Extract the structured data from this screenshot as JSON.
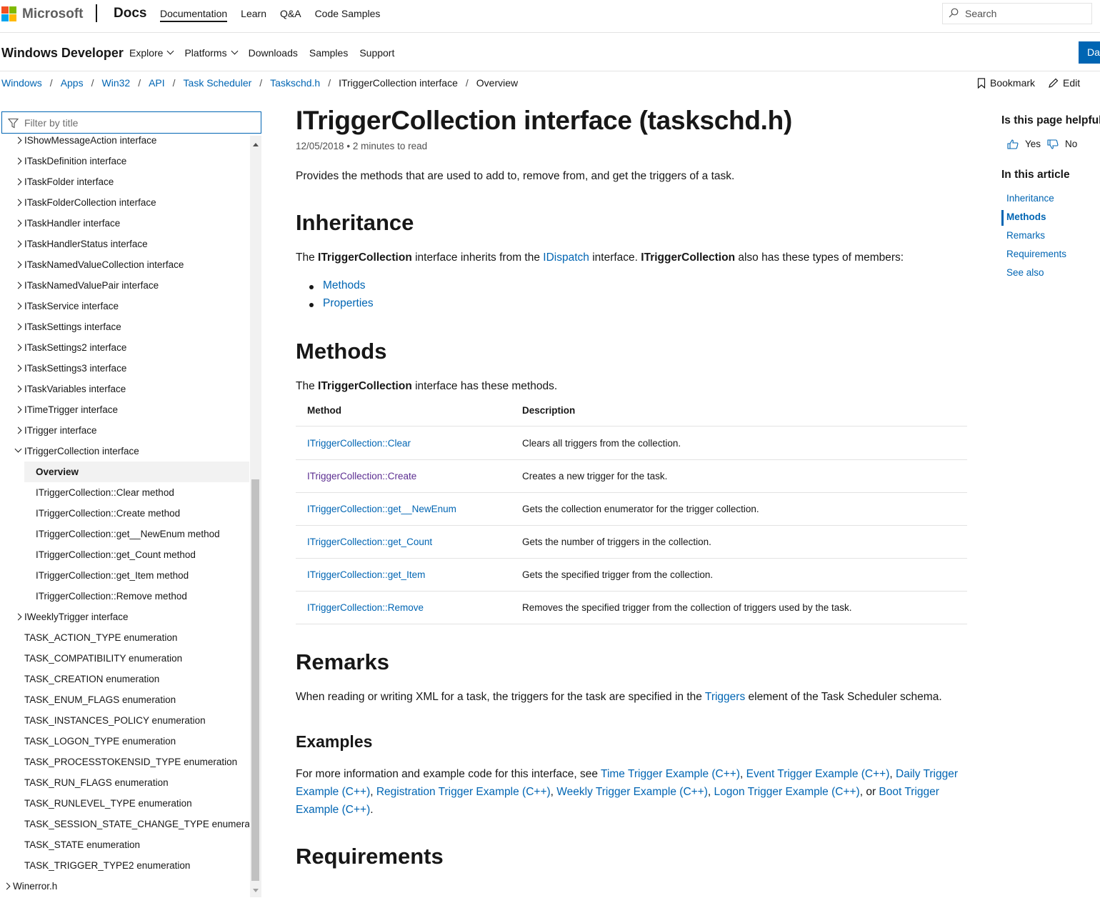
{
  "header": {
    "brand": "Microsoft",
    "site": "Docs",
    "nav": [
      "Documentation",
      "Learn",
      "Q&A",
      "Code Samples"
    ],
    "search_placeholder": "Search"
  },
  "subheader": {
    "title": "Windows Developer",
    "nav": [
      "Explore",
      "Platforms",
      "Downloads",
      "Samples",
      "Support"
    ],
    "button": "Da"
  },
  "breadcrumb": [
    "Windows",
    "Apps",
    "Win32",
    "API",
    "Task Scheduler",
    "Taskschd.h",
    "ITriggerCollection interface",
    "Overview"
  ],
  "actions": {
    "bookmark": "Bookmark",
    "edit": "Edit"
  },
  "sidebar": {
    "filter_placeholder": "Filter by title",
    "items": [
      {
        "label": "IShowMessageAction interface",
        "level": 1,
        "chevron": "closed"
      },
      {
        "label": "ITaskDefinition interface",
        "level": 1,
        "chevron": "closed"
      },
      {
        "label": "ITaskFolder interface",
        "level": 1,
        "chevron": "closed"
      },
      {
        "label": "ITaskFolderCollection interface",
        "level": 1,
        "chevron": "closed"
      },
      {
        "label": "ITaskHandler interface",
        "level": 1,
        "chevron": "closed"
      },
      {
        "label": "ITaskHandlerStatus interface",
        "level": 1,
        "chevron": "closed"
      },
      {
        "label": "ITaskNamedValueCollection interface",
        "level": 1,
        "chevron": "closed"
      },
      {
        "label": "ITaskNamedValuePair interface",
        "level": 1,
        "chevron": "closed"
      },
      {
        "label": "ITaskService interface",
        "level": 1,
        "chevron": "closed"
      },
      {
        "label": "ITaskSettings interface",
        "level": 1,
        "chevron": "closed"
      },
      {
        "label": "ITaskSettings2 interface",
        "level": 1,
        "chevron": "closed"
      },
      {
        "label": "ITaskSettings3 interface",
        "level": 1,
        "chevron": "closed"
      },
      {
        "label": "ITaskVariables interface",
        "level": 1,
        "chevron": "closed"
      },
      {
        "label": "ITimeTrigger interface",
        "level": 1,
        "chevron": "closed"
      },
      {
        "label": "ITrigger interface",
        "level": 1,
        "chevron": "closed"
      },
      {
        "label": "ITriggerCollection interface",
        "level": 1,
        "chevron": "open"
      },
      {
        "label": "Overview",
        "level": 2,
        "chevron": "none",
        "selected": true
      },
      {
        "label": "ITriggerCollection::Clear method",
        "level": 2,
        "chevron": "none"
      },
      {
        "label": "ITriggerCollection::Create method",
        "level": 2,
        "chevron": "none"
      },
      {
        "label": "ITriggerCollection::get__NewEnum method",
        "level": 2,
        "chevron": "none"
      },
      {
        "label": "ITriggerCollection::get_Count method",
        "level": 2,
        "chevron": "none"
      },
      {
        "label": "ITriggerCollection::get_Item method",
        "level": 2,
        "chevron": "none"
      },
      {
        "label": "ITriggerCollection::Remove method",
        "level": 2,
        "chevron": "none"
      },
      {
        "label": "IWeeklyTrigger interface",
        "level": 1,
        "chevron": "closed"
      },
      {
        "label": "TASK_ACTION_TYPE enumeration",
        "level": 1,
        "chevron": "none"
      },
      {
        "label": "TASK_COMPATIBILITY enumeration",
        "level": 1,
        "chevron": "none"
      },
      {
        "label": "TASK_CREATION enumeration",
        "level": 1,
        "chevron": "none"
      },
      {
        "label": "TASK_ENUM_FLAGS enumeration",
        "level": 1,
        "chevron": "none"
      },
      {
        "label": "TASK_INSTANCES_POLICY enumeration",
        "level": 1,
        "chevron": "none"
      },
      {
        "label": "TASK_LOGON_TYPE enumeration",
        "level": 1,
        "chevron": "none"
      },
      {
        "label": "TASK_PROCESSTOKENSID_TYPE enumeration",
        "level": 1,
        "chevron": "none"
      },
      {
        "label": "TASK_RUN_FLAGS enumeration",
        "level": 1,
        "chevron": "none"
      },
      {
        "label": "TASK_RUNLEVEL_TYPE enumeration",
        "level": 1,
        "chevron": "none"
      },
      {
        "label": "TASK_SESSION_STATE_CHANGE_TYPE enumeration",
        "level": 1,
        "chevron": "none"
      },
      {
        "label": "TASK_STATE enumeration",
        "level": 1,
        "chevron": "none"
      },
      {
        "label": "TASK_TRIGGER_TYPE2 enumeration",
        "level": 1,
        "chevron": "none"
      },
      {
        "label": "Winerror.h",
        "level": 0,
        "chevron": "closed"
      }
    ]
  },
  "article": {
    "title": "ITriggerCollection interface (taskschd.h)",
    "date": "12/05/2018",
    "read_time": "2 minutes to read",
    "intro": "Provides the methods that are used to add to, remove from, and get the triggers of a task.",
    "inheritance": {
      "heading": "Inheritance",
      "p_the": "The ",
      "name": "ITriggerCollection",
      "p_mid": " interface inherits from the ",
      "link": "IDispatch",
      "p_mid2": " interface. ",
      "name2": "ITriggerCollection",
      "p_end": " also has these types of members:",
      "bullets": [
        "Methods",
        "Properties"
      ]
    },
    "methods": {
      "heading": "Methods",
      "p_the": "The ",
      "name": "ITriggerCollection",
      "p_end": " interface has these methods.",
      "col_method": "Method",
      "col_desc": "Description",
      "rows": [
        {
          "method": "ITriggerCollection::Clear",
          "desc": "Clears all triggers from the collection."
        },
        {
          "method": "ITriggerCollection::Create",
          "desc": "Creates a new trigger for the task."
        },
        {
          "method": "ITriggerCollection::get__NewEnum",
          "desc": "Gets the collection enumerator for the trigger collection."
        },
        {
          "method": "ITriggerCollection::get_Count",
          "desc": "Gets the number of triggers in the collection."
        },
        {
          "method": "ITriggerCollection::get_Item",
          "desc": "Gets the specified trigger from the collection."
        },
        {
          "method": "ITriggerCollection::Remove",
          "desc": "Removes the specified trigger from the collection of triggers used by the task."
        }
      ]
    },
    "remarks": {
      "heading": "Remarks",
      "p_start": "When reading or writing XML for a task, the triggers for the task are specified in the ",
      "link": "Triggers",
      "p_end": " element of the Task Scheduler schema."
    },
    "examples": {
      "heading": "Examples",
      "p_start": "For more information and example code for this interface, see ",
      "links": [
        "Time Trigger Example (C++)",
        "Event Trigger Example (C++)",
        "Daily Trigger Example (C++)",
        "Registration Trigger Example (C++)",
        "Weekly Trigger Example (C++)",
        "Logon Trigger Example (C++)",
        "Boot Trigger Example (C++)"
      ]
    },
    "requirements": {
      "heading": "Requirements"
    }
  },
  "rail": {
    "feedback_q": "Is this page helpful?",
    "yes": "Yes",
    "no": "No",
    "in_article": "In this article",
    "links": [
      "Inheritance",
      "Methods",
      "Remarks",
      "Requirements",
      "See also"
    ],
    "active": "Methods"
  },
  "colors": {
    "link": "#0065b3",
    "visited": "#5c2e91",
    "text": "#171717",
    "border": "#e3e3e3",
    "selected_bg": "#f2f2f2"
  },
  "icons": [
    "microsoft-logo",
    "search-icon",
    "chevron-down-icon",
    "bookmark-icon",
    "edit-icon",
    "filter-icon",
    "thumbs-up-icon",
    "thumbs-down-icon"
  ]
}
